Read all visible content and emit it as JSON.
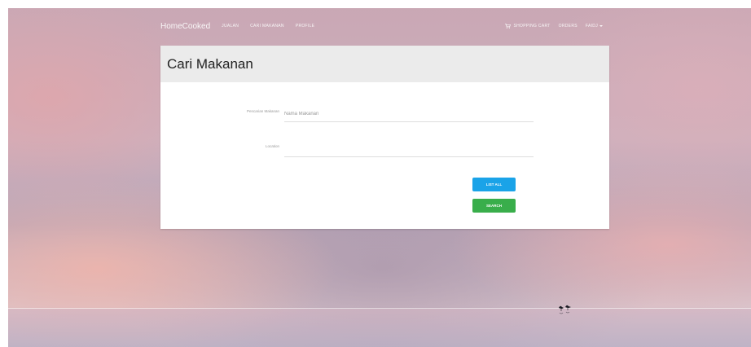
{
  "navbar": {
    "brand": "HomeCooked",
    "links": [
      "JUALAN",
      "CARI MAKANAN",
      "PROFILE"
    ],
    "right_links": {
      "cart": "SHOPPING CART",
      "orders": "ORDERS",
      "user": "FAIDJ"
    }
  },
  "panel": {
    "title": "Cari Makanan",
    "search_field": {
      "label": "Pencarian Makanan",
      "placeholder": "Nama Makanan",
      "value": ""
    },
    "location_field": {
      "label": "Location",
      "placeholder": "",
      "value": ""
    },
    "buttons": {
      "list_all": "LIST ALL",
      "search": "SEARCH"
    }
  },
  "colors": {
    "list_button": "#1aa3e8",
    "search_button": "#39ae4b",
    "panel_header": "#ebebeb"
  },
  "icons": {
    "cart": "shopping-cart-icon",
    "caret": "caret-down-icon"
  }
}
